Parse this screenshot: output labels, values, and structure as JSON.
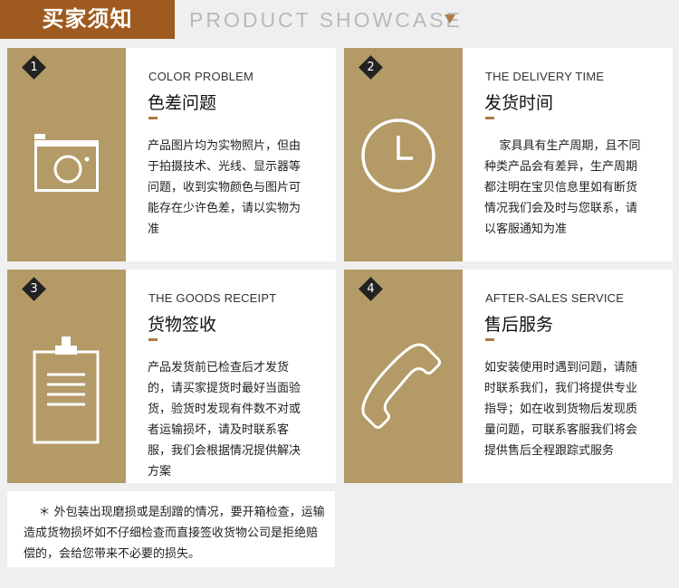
{
  "header": {
    "badge": "买家须知",
    "title": "PRODUCT  SHOWCASE",
    "arrow_icon": "triangle-down-icon"
  },
  "cards": [
    {
      "number": "1",
      "icon": "camera-icon",
      "en_title": "COLOR PROBLEM",
      "cn_title": "色差问题",
      "description": "产品图片均为实物照片，但由于拍摄技术、光线、显示器等问题，收到实物颜色与图片可能存在少许色差，请以实物为准"
    },
    {
      "number": "2",
      "icon": "clock-icon",
      "en_title": "THE DELIVERY TIME",
      "cn_title": "发货时间",
      "description": "    家具具有生产周期，且不同种类产品会有差异，生产周期都注明在宝贝信息里如有断货情况我们会及时与您联系，请以客服通知为准"
    },
    {
      "number": "3",
      "icon": "clipboard-icon",
      "en_title": "THE GOODS RECEIPT",
      "cn_title": "货物签收",
      "description": "产品发货前已检查后才发货的，请买家提货时最好当面验货，验货时发现有件数不对或者运输损坏，请及时联系客服，我们会根据情况提供解决方案"
    },
    {
      "number": "4",
      "icon": "phone-icon",
      "en_title": "AFTER-SALES SERVICE",
      "cn_title": "售后服务",
      "description": "如安装使用时遇到问题，请随时联系我们，我们将提供专业指导；如在收到货物后发现质量问题，可联系客服我们将会提供售后全程跟踪式服务"
    }
  ],
  "note": "    ＊ 外包装出现磨损或是刮蹭的情况，要开箱检查，运输造成货物损坏如不仔细检查而直接签收货物公司是拒绝赔偿的，会给您带来不必要的损失。",
  "colors": {
    "gold": "#b39a67",
    "brown": "#9f5a1f",
    "accent": "#b07a45"
  }
}
